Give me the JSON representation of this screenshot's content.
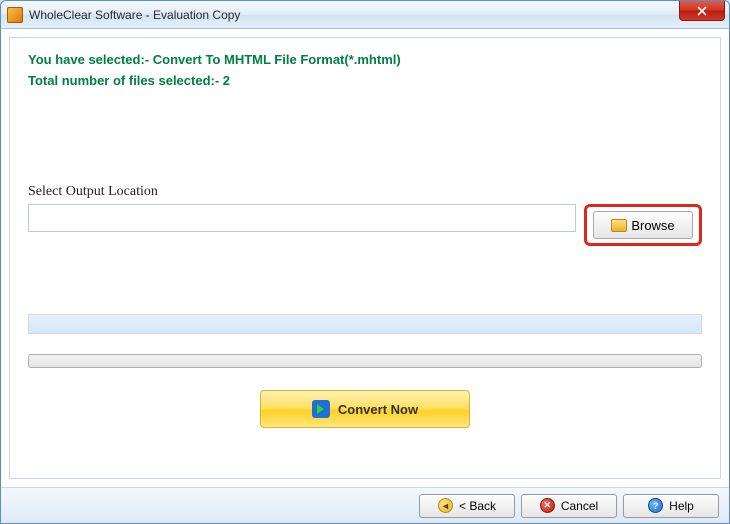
{
  "window": {
    "title": "WholeClear Software - Evaluation Copy"
  },
  "info": {
    "line1": "You have selected:- Convert To MHTML File Format(*.mhtml)",
    "line2": "Total number of files selected:- 2"
  },
  "output": {
    "label": "Select Output Location",
    "value": "",
    "browse_label": "Browse"
  },
  "actions": {
    "convert_label": "Convert Now"
  },
  "footer": {
    "back_label": "< Back",
    "cancel_label": "Cancel",
    "help_label": "Help"
  }
}
